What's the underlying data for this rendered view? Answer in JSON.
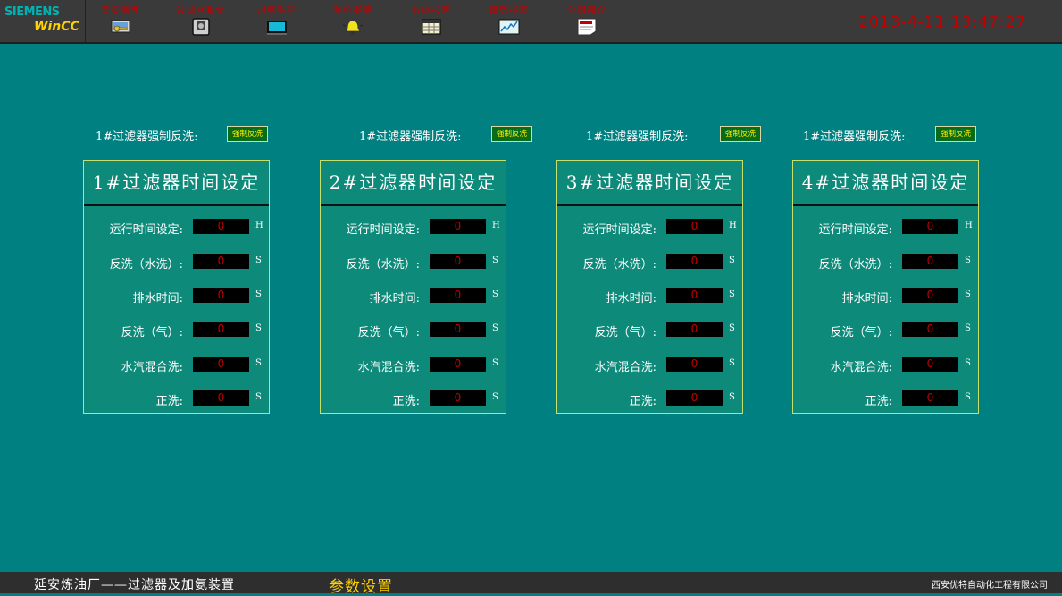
{
  "header": {
    "logo_brand": "SIEMENS",
    "logo_product": "WinCC",
    "datetime": "2013-4-11 13:47:27",
    "nav": [
      {
        "label": "登录画面",
        "icon": "login-key-icon"
      },
      {
        "label": "过滤器系统",
        "icon": "filter-device-icon"
      },
      {
        "label": "加氨系统",
        "icon": "ammonia-monitor-icon"
      },
      {
        "label": "系统报警",
        "icon": "alarm-bell-icon"
      },
      {
        "label": "数据报表",
        "icon": "data-table-icon"
      },
      {
        "label": "趋势报表",
        "icon": "trend-chart-icon"
      },
      {
        "label": "公司简介",
        "icon": "notice-paper-icon"
      }
    ]
  },
  "force_backwash": [
    {
      "label": "1#过滤器强制反洗:",
      "button": "强制反洗"
    },
    {
      "label": "1#过滤器强制反洗:",
      "button": "强制反洗"
    },
    {
      "label": "1#过滤器强制反洗:",
      "button": "强制反洗"
    },
    {
      "label": "1#过滤器强制反洗:",
      "button": "强制反洗"
    }
  ],
  "panels": [
    {
      "title": "1#过滤器时间设定",
      "rows": [
        {
          "label": "运行时间设定:",
          "value": "0",
          "unit": "H"
        },
        {
          "label": "反洗（水洗）:",
          "value": "0",
          "unit": "S"
        },
        {
          "label": "排水时间:",
          "value": "0",
          "unit": "S"
        },
        {
          "label": "反洗（气）:",
          "value": "0",
          "unit": "S"
        },
        {
          "label": "水汽混合洗:",
          "value": "0",
          "unit": "S"
        },
        {
          "label": "正洗:",
          "value": "0",
          "unit": "S"
        }
      ]
    },
    {
      "title": "2#过滤器时间设定",
      "rows": [
        {
          "label": "运行时间设定:",
          "value": "0",
          "unit": "H"
        },
        {
          "label": "反洗（水洗）:",
          "value": "0",
          "unit": "S"
        },
        {
          "label": "排水时间:",
          "value": "0",
          "unit": "S"
        },
        {
          "label": "反洗（气）:",
          "value": "0",
          "unit": "S"
        },
        {
          "label": "水汽混合洗:",
          "value": "0",
          "unit": "S"
        },
        {
          "label": "正洗:",
          "value": "0",
          "unit": "S"
        }
      ]
    },
    {
      "title": "3#过滤器时间设定",
      "rows": [
        {
          "label": "运行时间设定:",
          "value": "0",
          "unit": "H"
        },
        {
          "label": "反洗（水洗）:",
          "value": "0",
          "unit": "S"
        },
        {
          "label": "排水时间:",
          "value": "0",
          "unit": "S"
        },
        {
          "label": "反洗（气）:",
          "value": "0",
          "unit": "S"
        },
        {
          "label": "水汽混合洗:",
          "value": "0",
          "unit": "S"
        },
        {
          "label": "正洗:",
          "value": "0",
          "unit": "S"
        }
      ]
    },
    {
      "title": "4#过滤器时间设定",
      "rows": [
        {
          "label": "运行时间设定:",
          "value": "0",
          "unit": "H"
        },
        {
          "label": "反洗（水洗）:",
          "value": "0",
          "unit": "S"
        },
        {
          "label": "排水时间:",
          "value": "0",
          "unit": "S"
        },
        {
          "label": "反洗（气）:",
          "value": "0",
          "unit": "S"
        },
        {
          "label": "水汽混合洗:",
          "value": "0",
          "unit": "S"
        },
        {
          "label": "正洗:",
          "value": "0",
          "unit": "S"
        }
      ]
    }
  ],
  "footer": {
    "plant": "延安炼油厂——过滤器及加氨装置",
    "page_title": "参数设置",
    "company": "西安优特自动化工程有限公司"
  },
  "colors": {
    "background": "#008080",
    "panel_border": "#c8e06a",
    "value_text": "#c00000",
    "datetime": "#c00000",
    "page_title": "#ffd200"
  }
}
